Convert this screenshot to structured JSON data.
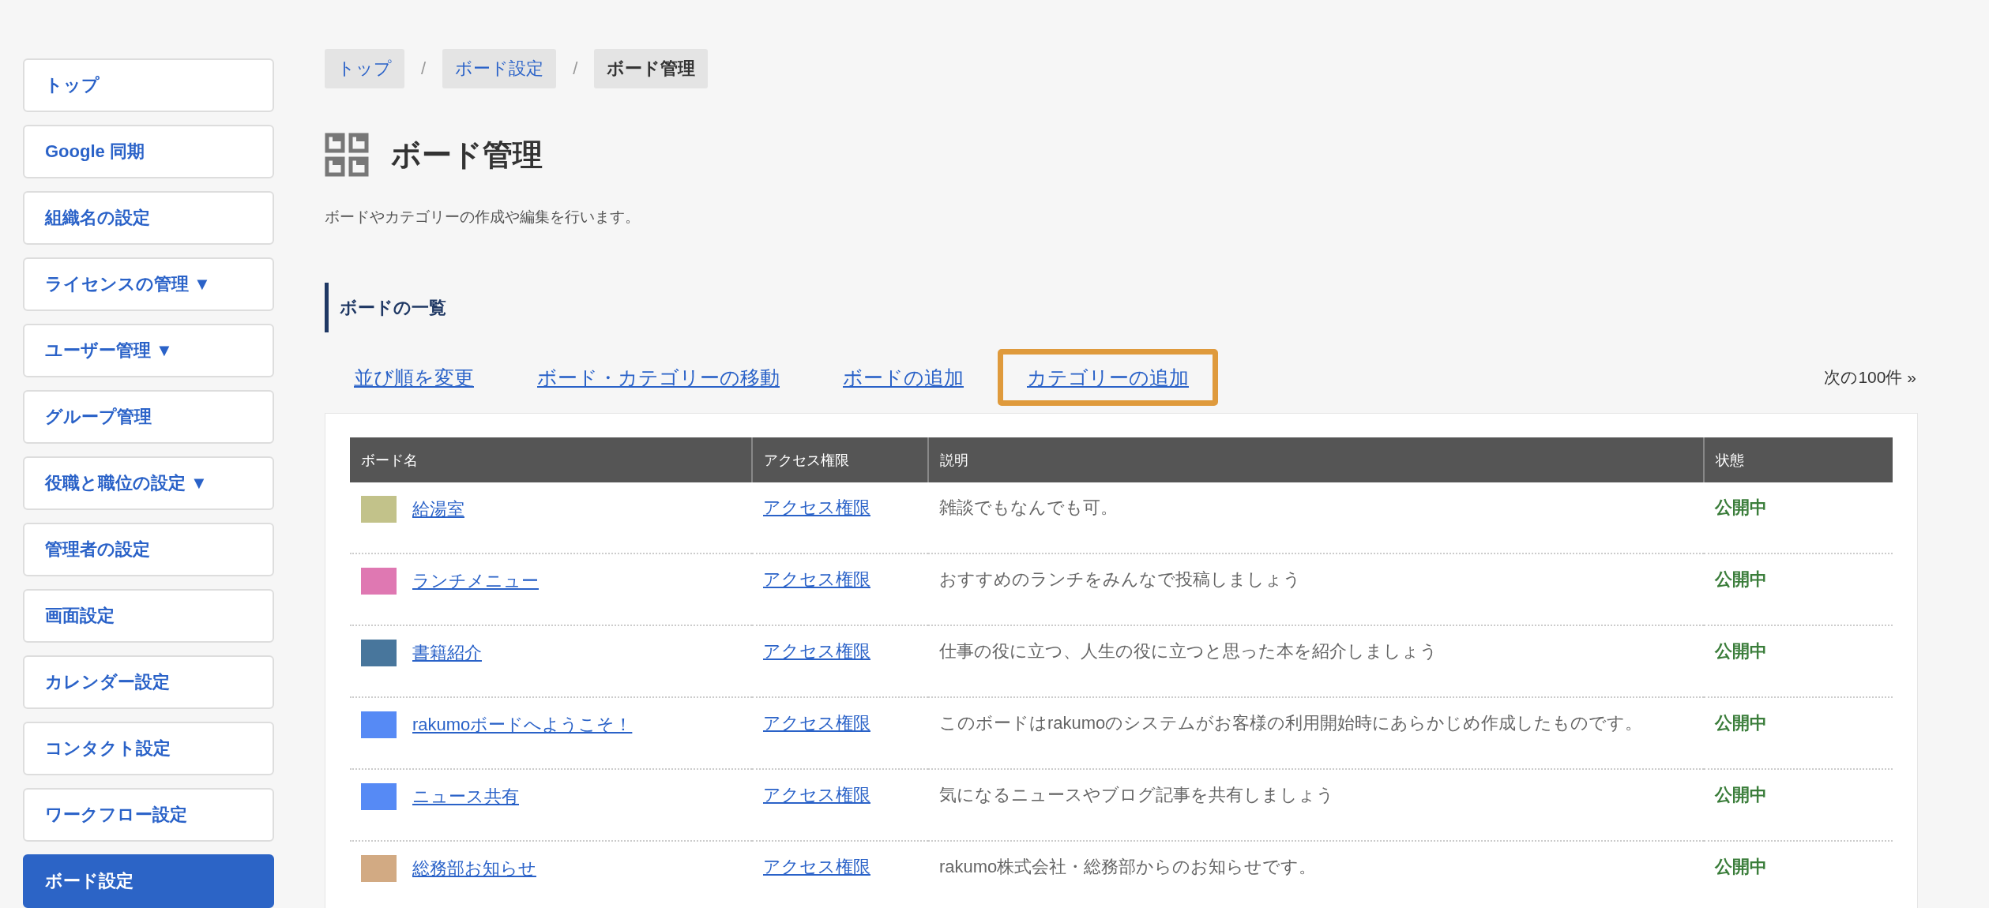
{
  "sidebar": {
    "items": [
      {
        "label": "トップ",
        "selected": false
      },
      {
        "label": "Google 同期",
        "selected": false
      },
      {
        "label": "組織名の設定",
        "selected": false
      },
      {
        "label": "ライセンスの管理 ▼",
        "selected": false
      },
      {
        "label": "ユーザー管理 ▼",
        "selected": false
      },
      {
        "label": "グループ管理",
        "selected": false
      },
      {
        "label": "役職と職位の設定 ▼",
        "selected": false
      },
      {
        "label": "管理者の設定",
        "selected": false
      },
      {
        "label": "画面設定",
        "selected": false
      },
      {
        "label": "カレンダー設定",
        "selected": false
      },
      {
        "label": "コンタクト設定",
        "selected": false
      },
      {
        "label": "ワークフロー設定",
        "selected": false
      },
      {
        "label": "ボード設定",
        "selected": true
      }
    ]
  },
  "breadcrumbs": [
    {
      "kind": "link",
      "label": "トップ"
    },
    {
      "kind": "separator",
      "label": "/"
    },
    {
      "kind": "link",
      "label": "ボード設定"
    },
    {
      "kind": "separator",
      "label": "/"
    },
    {
      "kind": "current",
      "label": "ボード管理"
    }
  ],
  "page": {
    "title": "ボード管理",
    "description": "ボードやカテゴリーの作成や編集を行います。"
  },
  "section": {
    "title": "ボードの一覧",
    "actions": [
      {
        "label": "並び順を変更",
        "highlighted": false
      },
      {
        "label": "ボード・カテゴリーの移動",
        "highlighted": false
      },
      {
        "label": "ボードの追加",
        "highlighted": false
      },
      {
        "label": "カテゴリーの追加",
        "highlighted": true
      }
    ],
    "next_page": "次の100件 »"
  },
  "table": {
    "columns": [
      "ボード名",
      "アクセス権限",
      "説明",
      "状態"
    ],
    "rows": [
      {
        "color": "#c2c28a",
        "name": "給湯室",
        "access": "アクセス権限",
        "description": "雑談でもなんでも可。",
        "status": "公開中"
      },
      {
        "color": "#df78b2",
        "name": "ランチメニュー",
        "access": "アクセス権限",
        "description": "おすすめのランチをみんなで投稿しましょう",
        "status": "公開中"
      },
      {
        "color": "#48769c",
        "name": "書籍紹介",
        "access": "アクセス権限",
        "description": "仕事の役に立つ、人生の役に立つと思った本を紹介しましょう",
        "status": "公開中"
      },
      {
        "color": "#568af5",
        "name": "rakumoボードへようこそ！",
        "access": "アクセス権限",
        "description": "このボードはrakumoのシステムがお客様の利用開始時にあらかじめ作成したものです。",
        "status": "公開中"
      },
      {
        "color": "#568af5",
        "name": "ニュース共有",
        "access": "アクセス権限",
        "description": "気になるニュースやブログ記事を共有しましょう",
        "status": "公開中"
      },
      {
        "color": "#d2aa83",
        "name": "総務部お知らせ",
        "access": "アクセス権限",
        "description": "rakumo株式会社・総務部からのお知らせです。",
        "status": "公開中"
      }
    ]
  }
}
